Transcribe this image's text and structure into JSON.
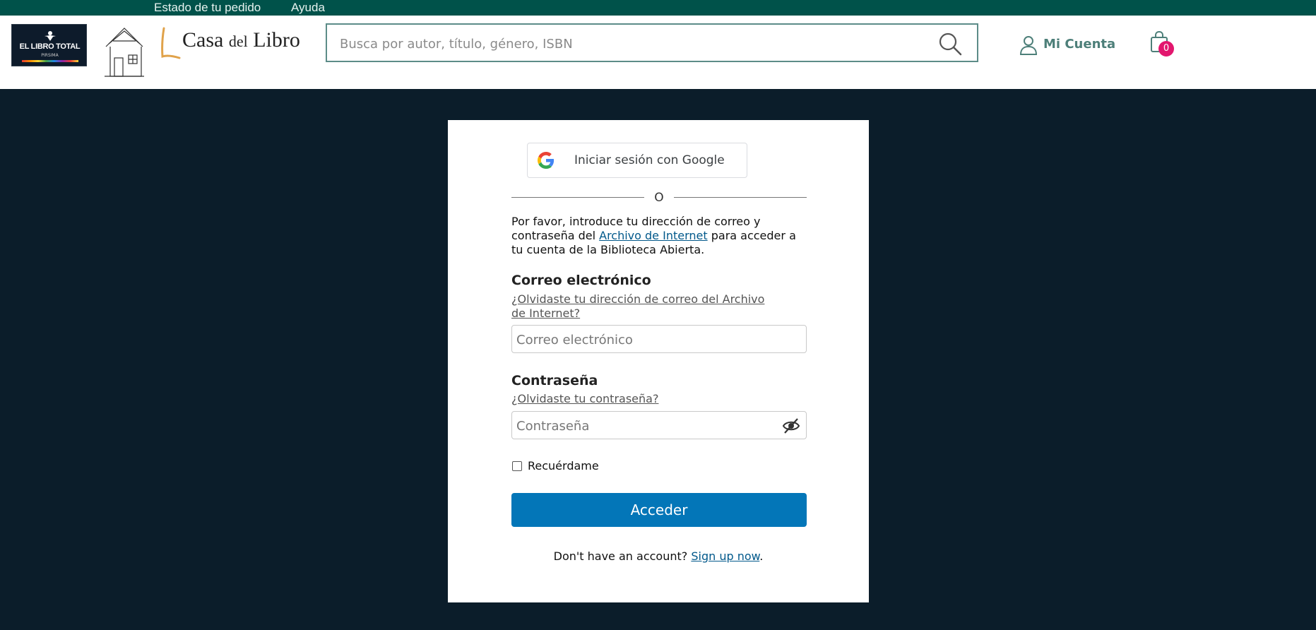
{
  "topbar": {
    "order_status": "Estado de tu pedido",
    "help": "Ayuda"
  },
  "header": {
    "partner_logo_text": "EL LIBRO TOTAL",
    "partner_logo_sub": "PIRSIMA",
    "brand_name_main": "Casa",
    "brand_name_mid": "del",
    "brand_name_end": "Libro",
    "search_placeholder": "Busca por autor, título, género, ISBN",
    "account_label": "Mi Cuenta",
    "cart_count": "0",
    "colors": {
      "topbar": "#00524a",
      "accent": "#4d7f79",
      "badge": "#e2176e"
    }
  },
  "login": {
    "google_button": "Iniciar sesión con Google",
    "or": "O",
    "intro_before": "Por favor, introduce tu dirección de correo y contraseña del ",
    "intro_link": "Archivo de Internet",
    "intro_after": " para acceder a tu cuenta de la Biblioteca Abierta.",
    "email_label": "Correo electrónico",
    "email_forgot": "¿Olvidaste tu dirección de correo del Archivo de Internet?",
    "email_placeholder": "Correo electrónico",
    "password_label": "Contraseña",
    "password_forgot": "¿Olvidaste tu contraseña?",
    "password_placeholder": "Contraseña",
    "remember_label": "Recuérdame",
    "submit_label": "Acceder",
    "signup_prompt": "Don't have an account?",
    "signup_link": "Sign up now",
    "signup_end": ".",
    "colors": {
      "primary": "#0376b8",
      "link": "#02598b",
      "page_bg": "#0b1d2a"
    }
  }
}
